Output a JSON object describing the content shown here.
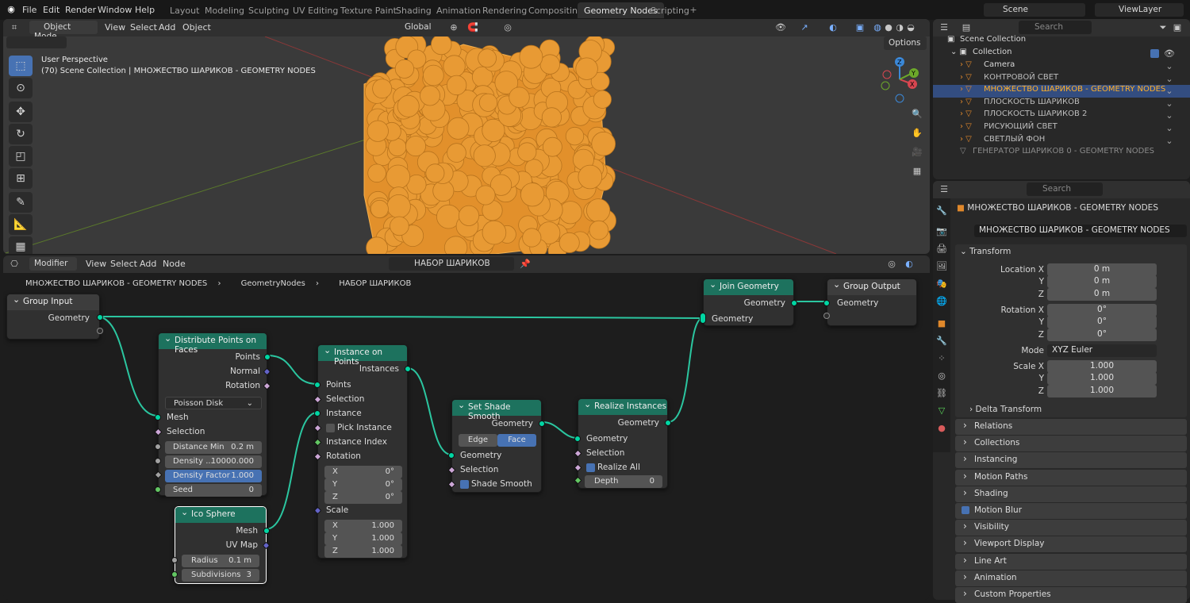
{
  "topbar": {
    "menus": [
      "File",
      "Edit",
      "Render",
      "Window",
      "Help"
    ],
    "workspaces": [
      "Layout",
      "Modeling",
      "Sculpting",
      "UV Editing",
      "Texture Paint",
      "Shading",
      "Animation",
      "Rendering",
      "Compositing",
      "Geometry Nodes",
      "Scripting"
    ],
    "active_workspace": "Geometry Nodes",
    "scene": "Scene",
    "view_layer": "ViewLayer"
  },
  "viewport": {
    "mode": "Object Mode",
    "menus": [
      "View",
      "Select",
      "Add",
      "Object"
    ],
    "transform": "Global",
    "options": "Options",
    "info_line1": "User Perspective",
    "info_line2": "(70) Scene Collection | МНОЖЕСТВО ШАРИКОВ - GEOMETRY NODES",
    "gizmo": {
      "x": "X",
      "y": "Y",
      "z": "Z"
    }
  },
  "node_editor": {
    "editor": "Modifier",
    "menus": [
      "View",
      "Select",
      "Add",
      "Node"
    ],
    "tree_name": "НАБОР ШАРИКОВ",
    "breadcrumb": [
      "МНОЖЕСТВО ШАРИКОВ - GEOMETRY NODES",
      "GeometryNodes",
      "НАБОР ШАРИКОВ"
    ],
    "nodes": {
      "group_input": {
        "title": "Group Input",
        "out": "Geometry"
      },
      "distribute": {
        "title": "Distribute Points on Faces",
        "outs": [
          "Points",
          "Normal",
          "Rotation"
        ],
        "method": "Poisson Disk",
        "ins": [
          "Mesh",
          "Selection"
        ],
        "distance_min_label": "Distance Min",
        "distance_min": "0.2 m",
        "density_label": "Density ...",
        "density": "10000.000",
        "density_factor_label": "Density Factor",
        "density_factor": "1.000",
        "seed_label": "Seed",
        "seed": "0"
      },
      "ico": {
        "title": "Ico Sphere",
        "outs": [
          "Mesh",
          "UV Map"
        ],
        "radius_label": "Radius",
        "radius": "0.1 m",
        "subdiv_label": "Subdivisions",
        "subdiv": "3"
      },
      "instance": {
        "title": "Instance on Points",
        "out": "Instances",
        "ins": [
          "Points",
          "Selection",
          "Instance"
        ],
        "pick": "Pick Instance",
        "ins2": [
          "Instance Index",
          "Rotation"
        ],
        "rot": [
          {
            "l": "X",
            "v": "0°"
          },
          {
            "l": "Y",
            "v": "0°"
          },
          {
            "l": "Z",
            "v": "0°"
          }
        ],
        "scale_label": "Scale",
        "scale": [
          {
            "l": "X",
            "v": "1.000"
          },
          {
            "l": "Y",
            "v": "1.000"
          },
          {
            "l": "Z",
            "v": "1.000"
          }
        ]
      },
      "shade": {
        "title": "Set Shade Smooth",
        "out": "Geometry",
        "edge": "Edge",
        "face": "Face",
        "ins": [
          "Geometry",
          "Selection"
        ],
        "smooth": "Shade Smooth"
      },
      "realize": {
        "title": "Realize Instances",
        "out": "Geometry",
        "ins": [
          "Geometry",
          "Selection"
        ],
        "realize_all": "Realize All",
        "depth_label": "Depth",
        "depth": "0"
      },
      "join": {
        "title": "Join Geometry",
        "out": "Geometry",
        "in": "Geometry"
      },
      "group_output": {
        "title": "Group Output",
        "in": "Geometry"
      }
    }
  },
  "outliner": {
    "search": "Search",
    "root": "Scene Collection",
    "collection": "Collection",
    "items": [
      {
        "name": "Camera"
      },
      {
        "name": "КОНТРОВОЙ СВЕТ"
      },
      {
        "name": "МНОЖЕСТВО ШАРИКОВ - GEOMETRY NODES"
      },
      {
        "name": "ПЛОСКОСТЬ ШАРИКОВ"
      },
      {
        "name": "ПЛОСКОСТЬ ШАРИКОВ 2"
      },
      {
        "name": "РИСУЮЩИЙ СВЕТ"
      },
      {
        "name": "СВЕТЛЫЙ ФОН"
      }
    ],
    "extra": "ГЕНЕРАТОР ШАРИКОВ 0 - GEOMETRY NODES"
  },
  "properties": {
    "search": "Search",
    "object_title": "МНОЖЕСТВО ШАРИКОВ - GEOMETRY NODES",
    "object_name": "МНОЖЕСТВО ШАРИКОВ - GEOMETRY NODES",
    "transform": "Transform",
    "location_label": "Location X",
    "location": [
      "0 m",
      "0 m",
      "0 m"
    ],
    "rotation_label": "Rotation X",
    "rotation": [
      "0°",
      "0°",
      "0°"
    ],
    "mode_label": "Mode",
    "mode": "XYZ Euler",
    "scale_label": "Scale X",
    "scale": [
      "1.000",
      "1.000",
      "1.000"
    ],
    "axis_y": "Y",
    "axis_z": "Z",
    "delta": "Delta Transform",
    "panels": [
      "Relations",
      "Collections",
      "Instancing",
      "Motion Paths",
      "Shading",
      "Motion Blur",
      "Visibility",
      "Viewport Display",
      "Line Art",
      "Animation",
      "Custom Properties"
    ]
  }
}
